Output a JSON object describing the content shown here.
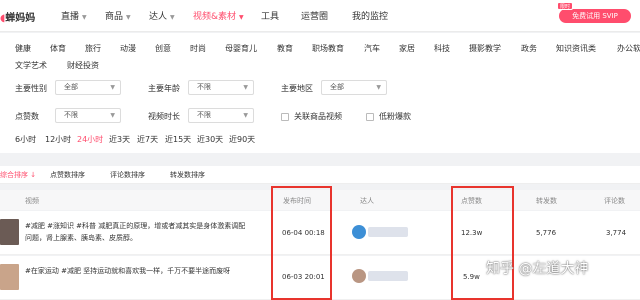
{
  "nav": {
    "logo_text": "蝉妈妈",
    "items": [
      "直播",
      "商品",
      "达人",
      "视频&素材",
      "工具",
      "运营圈",
      "我的监控"
    ],
    "svip_badge": "限时",
    "svip_button": "免费试用 SVIP"
  },
  "categories": [
    "健康",
    "体育",
    "旅行",
    "动漫",
    "创意",
    "时尚",
    "母婴育儿",
    "教育",
    "职场教育",
    "汽车",
    "家居",
    "科技",
    "摄影教学",
    "政务",
    "知识资讯类",
    "办公软件",
    "文学艺术",
    "财经投资"
  ],
  "filters": {
    "gender_label": "主要性别",
    "gender_value": "全部",
    "age_label": "主要年龄",
    "age_value": "不限",
    "region_label": "主要地区",
    "region_value": "全部",
    "likes_label": "点赞数",
    "likes_value": "不限",
    "duration_label": "视频时长",
    "duration_value": "不限",
    "related_goods": "关联商品视频",
    "low_fans": "低粉爆款"
  },
  "time_options": [
    "6小时",
    "12小时",
    "24小时",
    "近3天",
    "近7天",
    "近15天",
    "近30天",
    "近90天"
  ],
  "sort_options": [
    "综合排序 ↓",
    "点赞数排序",
    "评论数排序",
    "转发数排序"
  ],
  "table": {
    "headers": [
      "视频",
      "发布时间",
      "达人",
      "点赞数",
      "转发数",
      "评论数"
    ],
    "rows": [
      {
        "title": "#减肥 #涨知识 #科普 减肥真正的原理，增或者减其实是身体激素调配问题，肾上腺素、胰岛素、皮质醇。",
        "time": "06-04 00:18",
        "likes": "12.3w",
        "shares": "5,776",
        "comments": "3,774"
      },
      {
        "title": "#在家运动 #减肥 坚持运动就和喜欢我一样，千万不要半途而废呀",
        "time": "06-03 20:01",
        "likes": "5.9w",
        "shares": "",
        "comments": ""
      }
    ]
  },
  "watermark": "知乎 @左道大神",
  "colors": {
    "accent": "#ff4d6d",
    "highlight_box": "#e8342d"
  }
}
